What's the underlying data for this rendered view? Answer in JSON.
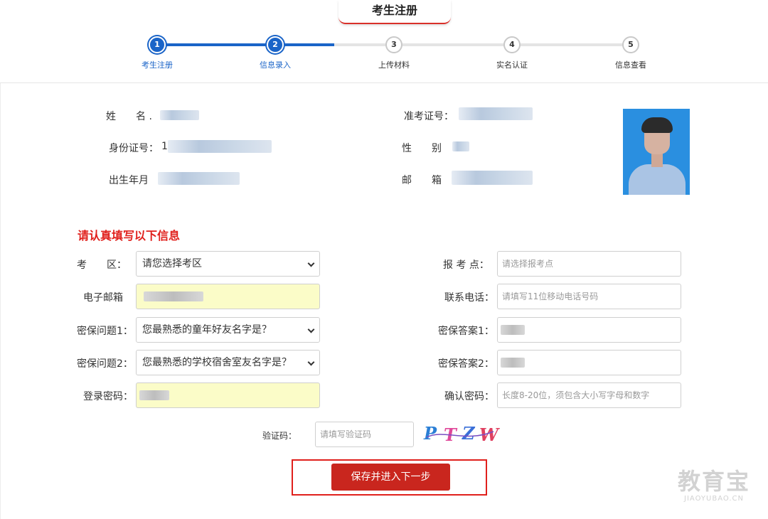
{
  "header": {
    "title": "考生注册"
  },
  "steps": [
    {
      "num": "1",
      "label": "考生注册",
      "state": "active"
    },
    {
      "num": "2",
      "label": "信息录入",
      "state": "active"
    },
    {
      "num": "3",
      "label": "上传材料",
      "state": "pending"
    },
    {
      "num": "4",
      "label": "实名认证",
      "state": "pending"
    },
    {
      "num": "5",
      "label": "信息查看",
      "state": "pending"
    }
  ],
  "info": {
    "name_label": "姓　　名 .",
    "exam_no_label": "准考证号：",
    "id_label": "身份证号：",
    "id_prefix": "1",
    "gender_label": "性　　别",
    "birth_label": "出生年月",
    "email_label": "邮　　箱"
  },
  "form": {
    "notice": "请认真填写以下信息",
    "exam_area_label": "考　　区：",
    "exam_area_value": "请您选择考区",
    "exam_site_label": "报 考 点：",
    "exam_site_placeholder": "请选择报考点",
    "email_label": "电子邮箱",
    "phone_label": "联系电话：",
    "phone_placeholder": "请填写11位移动电话号码",
    "q1_label": "密保问题1：",
    "q1_value": "您最熟悉的童年好友名字是？",
    "a1_label": "密保答案1：",
    "q2_label": "密保问题2：",
    "q2_value": "您最熟悉的学校宿舍室友名字是？",
    "a2_label": "密保答案2：",
    "pwd_label": "登录密码：",
    "confirm_label": "确认密码：",
    "confirm_placeholder": "长度8-20位，须包含大小写字母和数字",
    "captcha_label": "验证码：",
    "captcha_placeholder": "请填写验证码",
    "captcha_chars": [
      "P",
      "T",
      "Z",
      "W"
    ],
    "submit_label": "保存并进入下一步"
  },
  "watermark": {
    "big": "教育宝",
    "small": "JIAOYUBAO.CN"
  },
  "colors": {
    "primary_blue": "#1a64c8",
    "red": "#e0201c",
    "button_red": "#c9261e",
    "autofill_yellow": "#fbfcc8"
  }
}
